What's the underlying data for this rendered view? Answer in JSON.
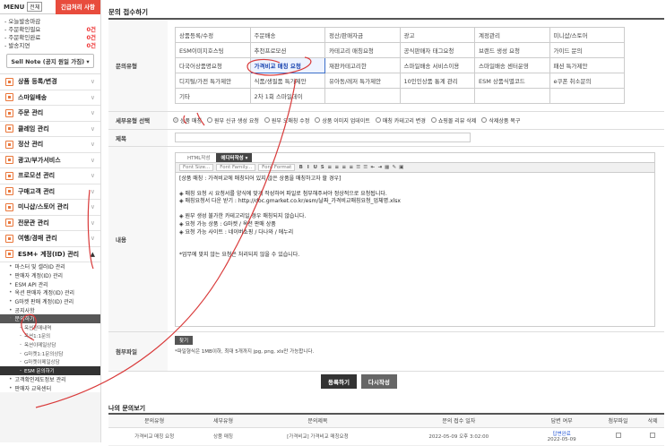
{
  "sidebar": {
    "menu_label": "MENU",
    "all_label": "전체",
    "urgent_label": "긴급처리 사항",
    "status": {
      "heading": "- 오늘발송마감",
      "rows": [
        {
          "label": "- 주문확인필요",
          "count": "0건"
        },
        {
          "label": "- 주문확인완료",
          "count": "0건"
        },
        {
          "label": "- 발송지연",
          "count": "0건"
        }
      ]
    },
    "sell_note": "Sell Note (공지 원일 가짐) ▾",
    "nav": [
      "상품 등록/변경",
      "스마일배송",
      "주문 관리",
      "클레임 관리",
      "정산 관리",
      "광고/부가서비스",
      "프로모션 관리",
      "구매고객 관리",
      "미니샵/스토어 관리",
      "전문관 관리",
      "여행/경매 관리"
    ],
    "open_section": "ESM+ 계정(ID) 관리",
    "sub_items": [
      "마스터 및 셀러ID 관리",
      "판매자 계정(ID) 관리",
      "ESM API 관리",
      "옥션 판매자 계정(ID) 관리",
      "G마켓 판매 계정(ID) 관리",
      "공지사항"
    ],
    "inquiry_label": "문의하기",
    "inquiry_items": [
      "옥션판매내역",
      "옥션1:1문의",
      "옥션이메일상담",
      "G마켓1:1문의상담",
      "G마켓이메일상담"
    ],
    "esm_inquiry": "ESM 문의하기",
    "tail_items": [
      "고객확인제도정보 관리",
      "판매자 교육센터"
    ]
  },
  "main": {
    "page_title": "문의 접수하기",
    "type_label": "문의유형",
    "types": [
      [
        "상품등록/수정",
        "주문배송",
        "정산/판매자금",
        "광고",
        "계정관리",
        "미니샵/스토어"
      ],
      [
        "ESM이미지호스팅",
        "추천프로모션",
        "카테고리 매칭요청",
        "공식판매자 태그요청",
        "브랜드 생성 요청",
        "가이드 문의"
      ],
      [
        "다국어상품명요청",
        "가격비교 매칭 요청",
        "재판카테고리한",
        "스마일배송 서비스이용",
        "스마일배송 센터운영",
        "패션 특가제안"
      ],
      [
        "디지털/가전 특가제안",
        "식품/생필품 특가제안",
        "유아동/레저 특가제안",
        "10인인상품 통계 관리",
        "ESM 상품식별코드",
        "e쿠폰 취소문의"
      ],
      [
        "기타",
        "2차 1회 스마일데이",
        "",
        "",
        "",
        ""
      ]
    ],
    "selected_type": "가격비교 매칭 요청",
    "detail_label": "세부유형 선택",
    "detail_options": [
      "상품 매칭",
      "원부 신규 생성 요청",
      "원부 오매칭 수정",
      "상품 이미지 업데이트",
      "매칭 카테고리 변경",
      "쇼핑몰 리뷰 삭제",
      "삭제상품 복구"
    ],
    "selected_detail": "상품 매칭",
    "title_label": "제목",
    "title_value": "",
    "content_label": "내용",
    "editor_tabs": [
      "HTML작성",
      "에디터작성 ▾"
    ],
    "toolbar": {
      "font_size": "Font Size...",
      "font_family": "Font Family...",
      "font_format": "Font Format"
    },
    "toolbar_icons": [
      "B",
      "I",
      "U",
      "S",
      "≡",
      "≡",
      "≡",
      "≡",
      "☰",
      "☰",
      "⇤",
      "⇥",
      "▦",
      "✎",
      "▣"
    ],
    "content_lines": [
      "[상품 매칭 : 가격비교에 매칭되어 있지 않은 상품을 매칭하고자 할 경우]",
      "",
      "◈ 매칭 요청 시 요청서를 양식에 맞게 작성하여 파일로 첨부해주셔야 정상적으로 요청됩니다.",
      "◈ 매칭요청서 다운 받기 : http://doc.gmarket.co.kr/esm/날짜_가격비교매칭요청_업체명.xlsx",
      "",
      "◈ 원부 생성 불가한 카테고리일 경우 매칭되지 않습니다.",
      "◈ 요청 가능 상품 : G마켓 / 옥션 판매 상품",
      "◈ 요청 가능 사이트 : 네이버쇼핑 / 다나와 / 에누리",
      "",
      "",
      "*업무에 맞지 않는 요청은 처리되지 않을 수 있습니다."
    ],
    "attach_label": "첨부파일",
    "find_button": "찾기",
    "file_note": "*파일형식은 1MB이하, 최대 5개까지 jpg, png, xls만 가능합니다.",
    "register_button": "등록하기",
    "temp_button": "다시작성",
    "list_title": "나의 문의보기",
    "list_headers": [
      "문의유형",
      "세부유형",
      "문의제목",
      "문의 접수 일자",
      "답변 여부",
      "첨부파일",
      "삭제"
    ],
    "list_rows": [
      {
        "type": "가격비교 매칭 요청",
        "detail": "상품 매칭",
        "title": "[가격비교] 가격비교 매칭요청",
        "date": "2022-05-09 오후 3:02:00",
        "answer": "답변완료",
        "answer_date": "2022-05-09"
      }
    ]
  }
}
